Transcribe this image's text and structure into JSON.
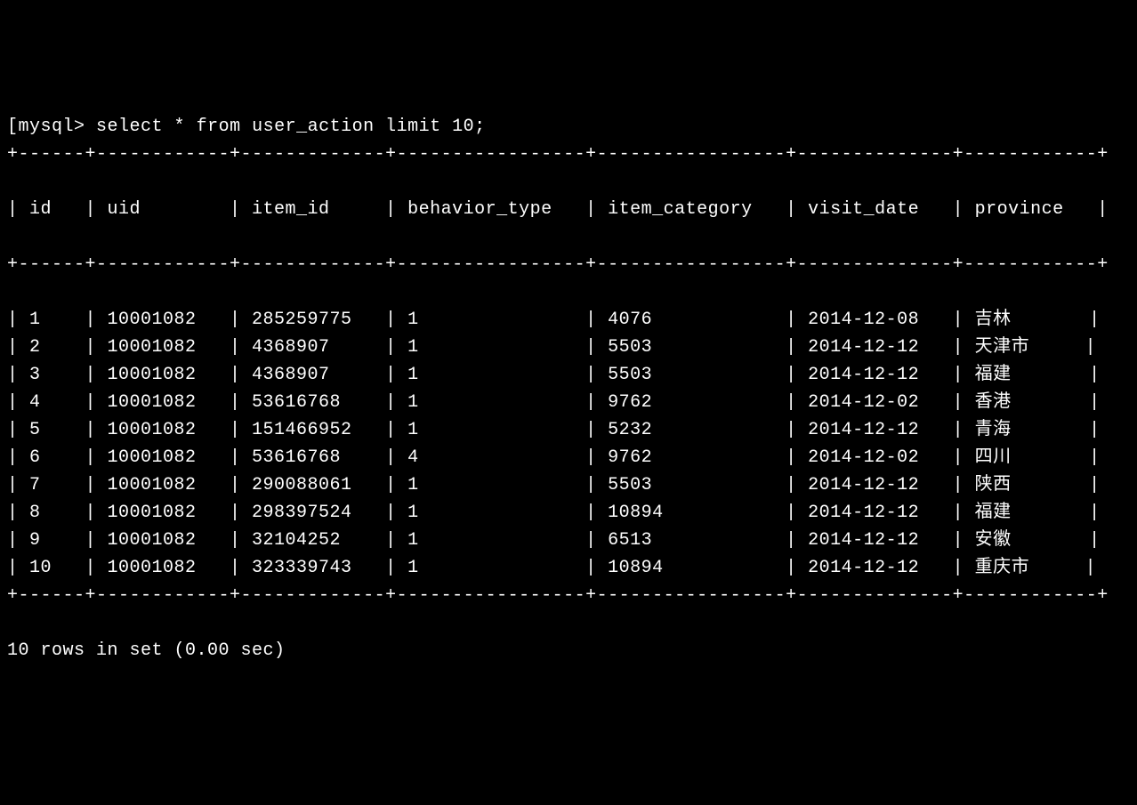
{
  "prompt": {
    "bracket_open": "[",
    "label": "mysql>",
    "query": "select * from user_action limit 10;",
    "bracket_close": "]"
  },
  "table": {
    "columns": [
      "id",
      "uid",
      "item_id",
      "behavior_type",
      "item_category",
      "visit_date",
      "province"
    ],
    "rows": [
      {
        "id": "1",
        "uid": "10001082",
        "item_id": "285259775",
        "behavior_type": "1",
        "item_category": "4076",
        "visit_date": "2014-12-08",
        "province": "吉林"
      },
      {
        "id": "2",
        "uid": "10001082",
        "item_id": "4368907",
        "behavior_type": "1",
        "item_category": "5503",
        "visit_date": "2014-12-12",
        "province": "天津市"
      },
      {
        "id": "3",
        "uid": "10001082",
        "item_id": "4368907",
        "behavior_type": "1",
        "item_category": "5503",
        "visit_date": "2014-12-12",
        "province": "福建"
      },
      {
        "id": "4",
        "uid": "10001082",
        "item_id": "53616768",
        "behavior_type": "1",
        "item_category": "9762",
        "visit_date": "2014-12-02",
        "province": "香港"
      },
      {
        "id": "5",
        "uid": "10001082",
        "item_id": "151466952",
        "behavior_type": "1",
        "item_category": "5232",
        "visit_date": "2014-12-12",
        "province": "青海"
      },
      {
        "id": "6",
        "uid": "10001082",
        "item_id": "53616768",
        "behavior_type": "4",
        "item_category": "9762",
        "visit_date": "2014-12-02",
        "province": "四川"
      },
      {
        "id": "7",
        "uid": "10001082",
        "item_id": "290088061",
        "behavior_type": "1",
        "item_category": "5503",
        "visit_date": "2014-12-12",
        "province": "陕西"
      },
      {
        "id": "8",
        "uid": "10001082",
        "item_id": "298397524",
        "behavior_type": "1",
        "item_category": "10894",
        "visit_date": "2014-12-12",
        "province": "福建"
      },
      {
        "id": "9",
        "uid": "10001082",
        "item_id": "32104252",
        "behavior_type": "1",
        "item_category": "6513",
        "visit_date": "2014-12-12",
        "province": "安徽"
      },
      {
        "id": "10",
        "uid": "10001082",
        "item_id": "323339743",
        "behavior_type": "1",
        "item_category": "10894",
        "visit_date": "2014-12-12",
        "province": "重庆市"
      }
    ],
    "column_widths": {
      "id": 4,
      "uid": 10,
      "item_id": 11,
      "behavior_type": 15,
      "item_category": 15,
      "visit_date": 12,
      "province": 10
    }
  },
  "footer": "10 rows in set (0.00 sec)"
}
